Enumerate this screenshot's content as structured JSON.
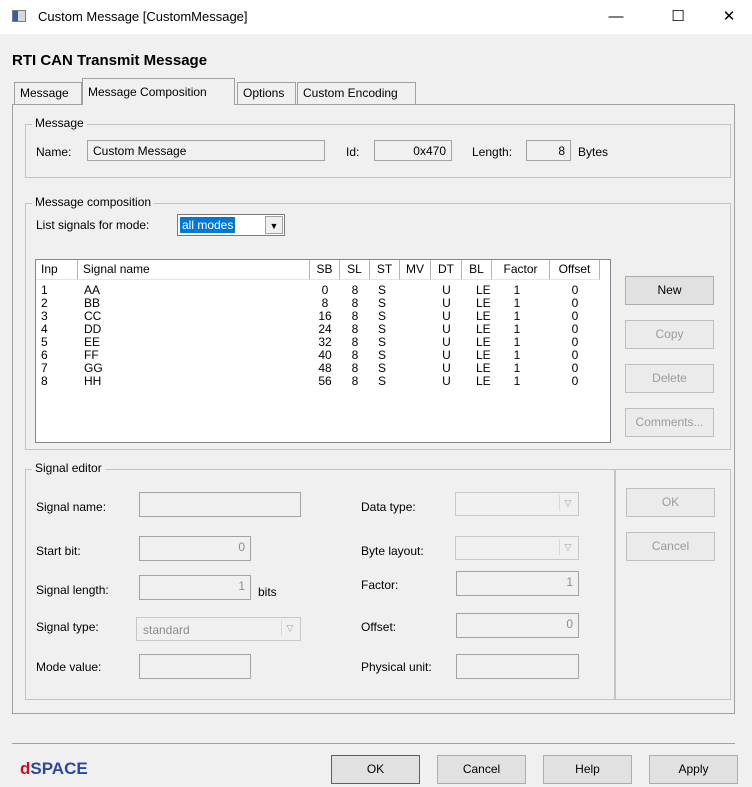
{
  "window": {
    "title": "Custom Message  [CustomMessage]",
    "minimize_glyph": "—",
    "maximize_glyph": "☐",
    "close_glyph": "✕"
  },
  "heading": "RTI CAN  Transmit Message",
  "tabs": [
    {
      "label": "Message",
      "active": false
    },
    {
      "label": "Message Composition",
      "active": true
    },
    {
      "label": "Options",
      "active": false
    },
    {
      "label": "Custom Encoding",
      "active": false
    }
  ],
  "message_group": {
    "title": "Message",
    "name_label": "Name:",
    "name_value": "Custom Message",
    "id_label": "Id:",
    "id_value": "0x470",
    "length_label": "Length:",
    "length_value": "8",
    "length_unit": "Bytes"
  },
  "composition_group": {
    "title": "Message composition",
    "mode_label": "List signals for mode:",
    "mode_value": "all modes",
    "columns": [
      "Inp",
      "Signal name",
      "SB",
      "SL",
      "ST",
      "MV",
      "DT",
      "BL",
      "Factor",
      "Offset"
    ],
    "rows": [
      [
        "1",
        "AA",
        "0",
        "8",
        "S",
        "",
        "U",
        "LE",
        "1",
        "0"
      ],
      [
        "2",
        "BB",
        "8",
        "8",
        "S",
        "",
        "U",
        "LE",
        "1",
        "0"
      ],
      [
        "3",
        "CC",
        "16",
        "8",
        "S",
        "",
        "U",
        "LE",
        "1",
        "0"
      ],
      [
        "4",
        "DD",
        "24",
        "8",
        "S",
        "",
        "U",
        "LE",
        "1",
        "0"
      ],
      [
        "5",
        "EE",
        "32",
        "8",
        "S",
        "",
        "U",
        "LE",
        "1",
        "0"
      ],
      [
        "6",
        "FF",
        "40",
        "8",
        "S",
        "",
        "U",
        "LE",
        "1",
        "0"
      ],
      [
        "7",
        "GG",
        "48",
        "8",
        "S",
        "",
        "U",
        "LE",
        "1",
        "0"
      ],
      [
        "8",
        "HH",
        "56",
        "8",
        "S",
        "",
        "U",
        "LE",
        "1",
        "0"
      ]
    ],
    "buttons": {
      "new": "New",
      "copy": "Copy",
      "delete": "Delete",
      "comments": "Comments..."
    }
  },
  "signal_editor": {
    "title": "Signal editor",
    "signal_name_label": "Signal name:",
    "signal_name_value": "",
    "start_bit_label": "Start bit:",
    "start_bit_value": "0",
    "signal_length_label": "Signal length:",
    "signal_length_value": "1",
    "signal_length_unit": "bits",
    "signal_type_label": "Signal type:",
    "signal_type_value": "standard",
    "mode_value_label": "Mode value:",
    "mode_value_value": "",
    "data_type_label": "Data type:",
    "data_type_value": "",
    "byte_layout_label": "Byte layout:",
    "byte_layout_value": "",
    "factor_label": "Factor:",
    "factor_value": "1",
    "offset_label": "Offset:",
    "offset_value": "0",
    "physical_unit_label": "Physical unit:",
    "physical_unit_value": "",
    "ok": "OK",
    "cancel": "Cancel"
  },
  "footer": {
    "logo_d": "d",
    "logo_rest": "SPACE",
    "ok": "OK",
    "cancel": "Cancel",
    "help": "Help",
    "apply": "Apply"
  },
  "icons": {
    "dropdown": "▼",
    "dropdown_disabled": "▽"
  },
  "colors": {
    "selection": "#0078d7",
    "logo_blue": "#2b4a9b",
    "logo_red": "#c8102e"
  }
}
